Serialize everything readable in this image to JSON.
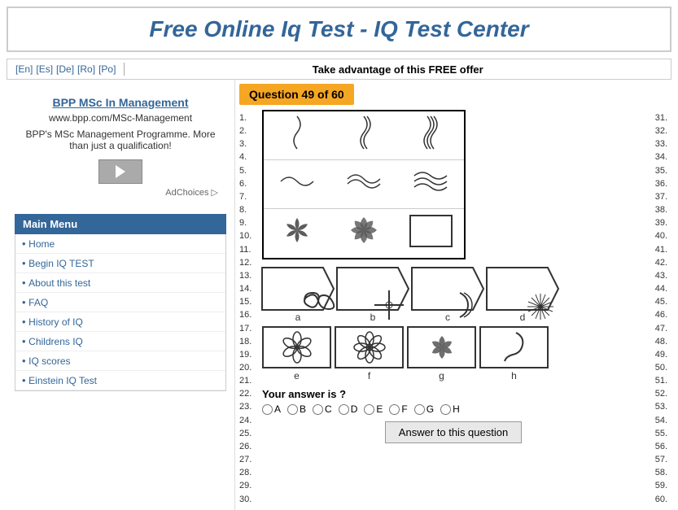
{
  "header": {
    "title": "Free Online Iq Test - IQ Test Center"
  },
  "lang_bar": {
    "langs": [
      "[En]",
      "[Es]",
      "[De]",
      "[Ro]",
      "[Po]"
    ],
    "offer": "Take advantage of this FREE offer"
  },
  "ad": {
    "title": "BPP MSc In Management",
    "url": "www.bpp.com/MSc-Management",
    "desc": "BPP's MSc Management Programme. More than just a qualification!",
    "btn_label": "→",
    "ad_choices": "AdChoices ▷"
  },
  "menu": {
    "label": "Main Menu",
    "items": [
      {
        "label": "Home",
        "href": "#"
      },
      {
        "label": "Begin IQ TEST",
        "href": "#"
      },
      {
        "label": "About this test",
        "href": "#"
      },
      {
        "label": "FAQ",
        "href": "#"
      },
      {
        "label": "History of IQ",
        "href": "#"
      },
      {
        "label": "Childrens IQ",
        "href": "#"
      },
      {
        "label": "IQ scores",
        "href": "#"
      },
      {
        "label": "Einstein IQ Test",
        "href": "#"
      }
    ]
  },
  "question": {
    "label": "Question 49 of 60",
    "answer_prompt": "Your answer is ?",
    "answer_btn": "Answer to this question",
    "radio_options": [
      "A",
      "B",
      "C",
      "D",
      "E",
      "F",
      "G",
      "H"
    ],
    "choice_labels": [
      "a",
      "b",
      "c",
      "d",
      "e",
      "f",
      "g",
      "h"
    ]
  },
  "row_numbers_left": [
    "1.",
    "2.",
    "3.",
    "4.",
    "5.",
    "6.",
    "7.",
    "8.",
    "9.",
    "10.",
    "11.",
    "12.",
    "13.",
    "14.",
    "15.",
    "16.",
    "17.",
    "18.",
    "19.",
    "20.",
    "21.",
    "22.",
    "23.",
    "24.",
    "25.",
    "26.",
    "27.",
    "28.",
    "29.",
    "30."
  ],
  "row_numbers_right": [
    "31.",
    "32.",
    "33.",
    "34.",
    "35.",
    "36.",
    "37.",
    "38.",
    "39.",
    "40.",
    "41.",
    "42.",
    "43.",
    "44.",
    "45.",
    "46.",
    "47.",
    "48.",
    "49.",
    "50.",
    "51.",
    "52.",
    "53.",
    "54.",
    "55.",
    "56.",
    "57.",
    "58.",
    "59.",
    "60."
  ]
}
